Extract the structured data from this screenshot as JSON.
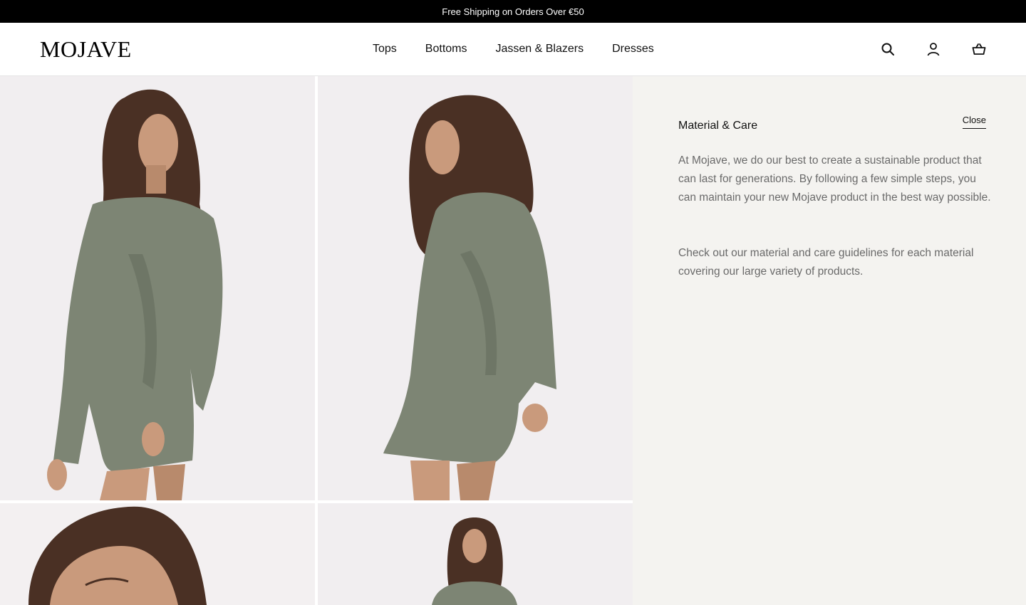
{
  "promo": {
    "text": "Free Shipping on Orders Over €50"
  },
  "header": {
    "logo": "MOJAVE",
    "nav": [
      {
        "label": "Tops"
      },
      {
        "label": "Bottoms"
      },
      {
        "label": "Jassen & Blazers"
      },
      {
        "label": "Dresses"
      }
    ],
    "icons": [
      "search-icon",
      "account-icon",
      "cart-icon"
    ]
  },
  "gallery": {
    "images": [
      "model-front-dress",
      "model-back-dress",
      "model-closeup-hair",
      "model-full-length"
    ],
    "dress_color": "#7d8574"
  },
  "panel": {
    "title": "Material & Care",
    "close_label": "Close",
    "paragraphs": [
      "At Mojave, we do our best to create a sustainable product that can last for generations. By following a few simple steps, you can maintain your new Mojave product in the best way possible.",
      "Check out our material and care guidelines for each material covering our large variety of products."
    ],
    "background": "#f4f3f0"
  }
}
